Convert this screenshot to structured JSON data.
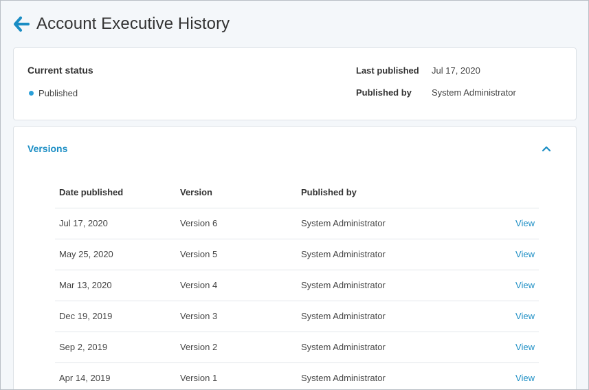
{
  "colors": {
    "accent": "#1a8dc4",
    "status_dot": "#2a9fd8"
  },
  "header": {
    "back_icon": "arrow-left-icon",
    "title": "Account Executive History"
  },
  "status": {
    "heading": "Current status",
    "value": "Published",
    "last_published_label": "Last published",
    "last_published_value": "Jul 17, 2020",
    "published_by_label": "Published by",
    "published_by_value": "System Administrator"
  },
  "versions": {
    "title": "Versions",
    "collapse_icon": "chevron-up-icon",
    "columns": [
      "Date published",
      "Version",
      "Published by",
      ""
    ],
    "rows": [
      {
        "date": "Jul 17, 2020",
        "version": "Version 6",
        "by": "System Administrator",
        "action": "View"
      },
      {
        "date": "May 25, 2020",
        "version": "Version 5",
        "by": "System Administrator",
        "action": "View"
      },
      {
        "date": "Mar 13, 2020",
        "version": "Version 4",
        "by": "System Administrator",
        "action": "View"
      },
      {
        "date": "Dec 19, 2019",
        "version": "Version 3",
        "by": "System Administrator",
        "action": "View"
      },
      {
        "date": "Sep 2, 2019",
        "version": "Version 2",
        "by": "System Administrator",
        "action": "View"
      },
      {
        "date": "Apr 14, 2019",
        "version": "Version 1",
        "by": "System Administrator",
        "action": "View"
      }
    ]
  }
}
